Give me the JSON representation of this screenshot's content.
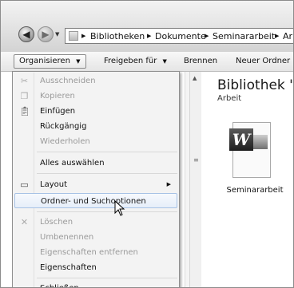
{
  "address": {
    "segments": [
      "Bibliotheken",
      "Dokumente",
      "Seminararbeit",
      "Arb"
    ]
  },
  "toolbar": {
    "organize": "Organisieren",
    "share": "Freigeben für",
    "burn": "Brennen",
    "new_folder": "Neuer Ordner"
  },
  "library": {
    "title": "Bibliothek \"De",
    "subtitle": "Arbeit"
  },
  "file": {
    "name": "Seminararbeit",
    "icon": "word-document-icon"
  },
  "menu": {
    "items": [
      {
        "label": "Ausschneiden",
        "disabled": true,
        "icon": "scissors-icon"
      },
      {
        "label": "Kopieren",
        "disabled": true,
        "icon": "copy-icon"
      },
      {
        "label": "Einfügen",
        "disabled": false,
        "icon": "clipboard-icon"
      },
      {
        "label": "Rückgängig",
        "disabled": false
      },
      {
        "label": "Wiederholen",
        "disabled": true
      },
      {
        "label": "Alles auswählen",
        "disabled": false
      },
      {
        "label": "Layout",
        "disabled": false,
        "icon": "layout-icon",
        "submenu": true
      },
      {
        "label": "Ordner- und Suchoptionen",
        "disabled": false,
        "highlighted": true
      },
      {
        "label": "Löschen",
        "disabled": true,
        "icon": "delete-x-icon"
      },
      {
        "label": "Umbenennen",
        "disabled": true
      },
      {
        "label": "Eigenschaften entfernen",
        "disabled": true
      },
      {
        "label": "Eigenschaften",
        "disabled": false
      },
      {
        "label": "Schließen",
        "disabled": false
      }
    ]
  }
}
